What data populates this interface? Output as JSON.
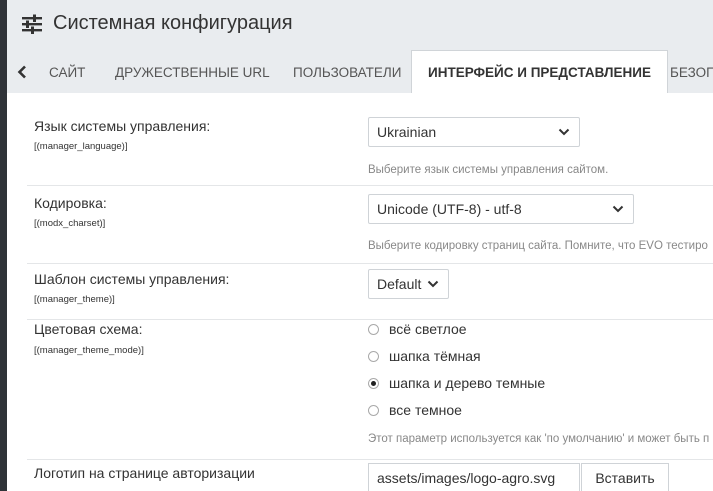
{
  "header": {
    "title": "Системная конфигурация",
    "icon": "sliders-icon"
  },
  "tabs": [
    {
      "label": "САЙТ"
    },
    {
      "label": "ДРУЖЕСТВЕННЫЕ URL"
    },
    {
      "label": "ПОЛЬЗОВАТЕЛИ"
    },
    {
      "label": "ИНТЕРФЕЙС И ПРЕДСТАВЛЕНИЕ"
    },
    {
      "label": "БЕЗОП"
    }
  ],
  "settings": {
    "language": {
      "label": "Язык системы управления:",
      "key": "[(manager_language)]",
      "value": "Ukrainian",
      "help": "Выберите язык системы управления сайтом."
    },
    "charset": {
      "label": "Кодировка:",
      "key": "[(modx_charset)]",
      "value": "Unicode (UTF-8) - utf-8",
      "help": "Выберите кодировку страниц сайта. Помните, что EVO тестиро"
    },
    "theme": {
      "label": "Шаблон системы управления:",
      "key": "[(manager_theme)]",
      "value": "Default"
    },
    "theme_mode": {
      "label": "Цветовая схема:",
      "key": "[(manager_theme_mode)]",
      "options": [
        {
          "label": "всё светлое",
          "checked": false
        },
        {
          "label": "шапка тёмная",
          "checked": false
        },
        {
          "label": "шапка и дерево темные",
          "checked": true
        },
        {
          "label": "все темное",
          "checked": false
        }
      ],
      "help": "Этот параметр используется как 'по умолчанию' и может быть п"
    },
    "login_logo": {
      "label": "Логотип на странице авторизации",
      "value": "assets/images/logo-agro.svg",
      "button": "Вставить"
    }
  }
}
